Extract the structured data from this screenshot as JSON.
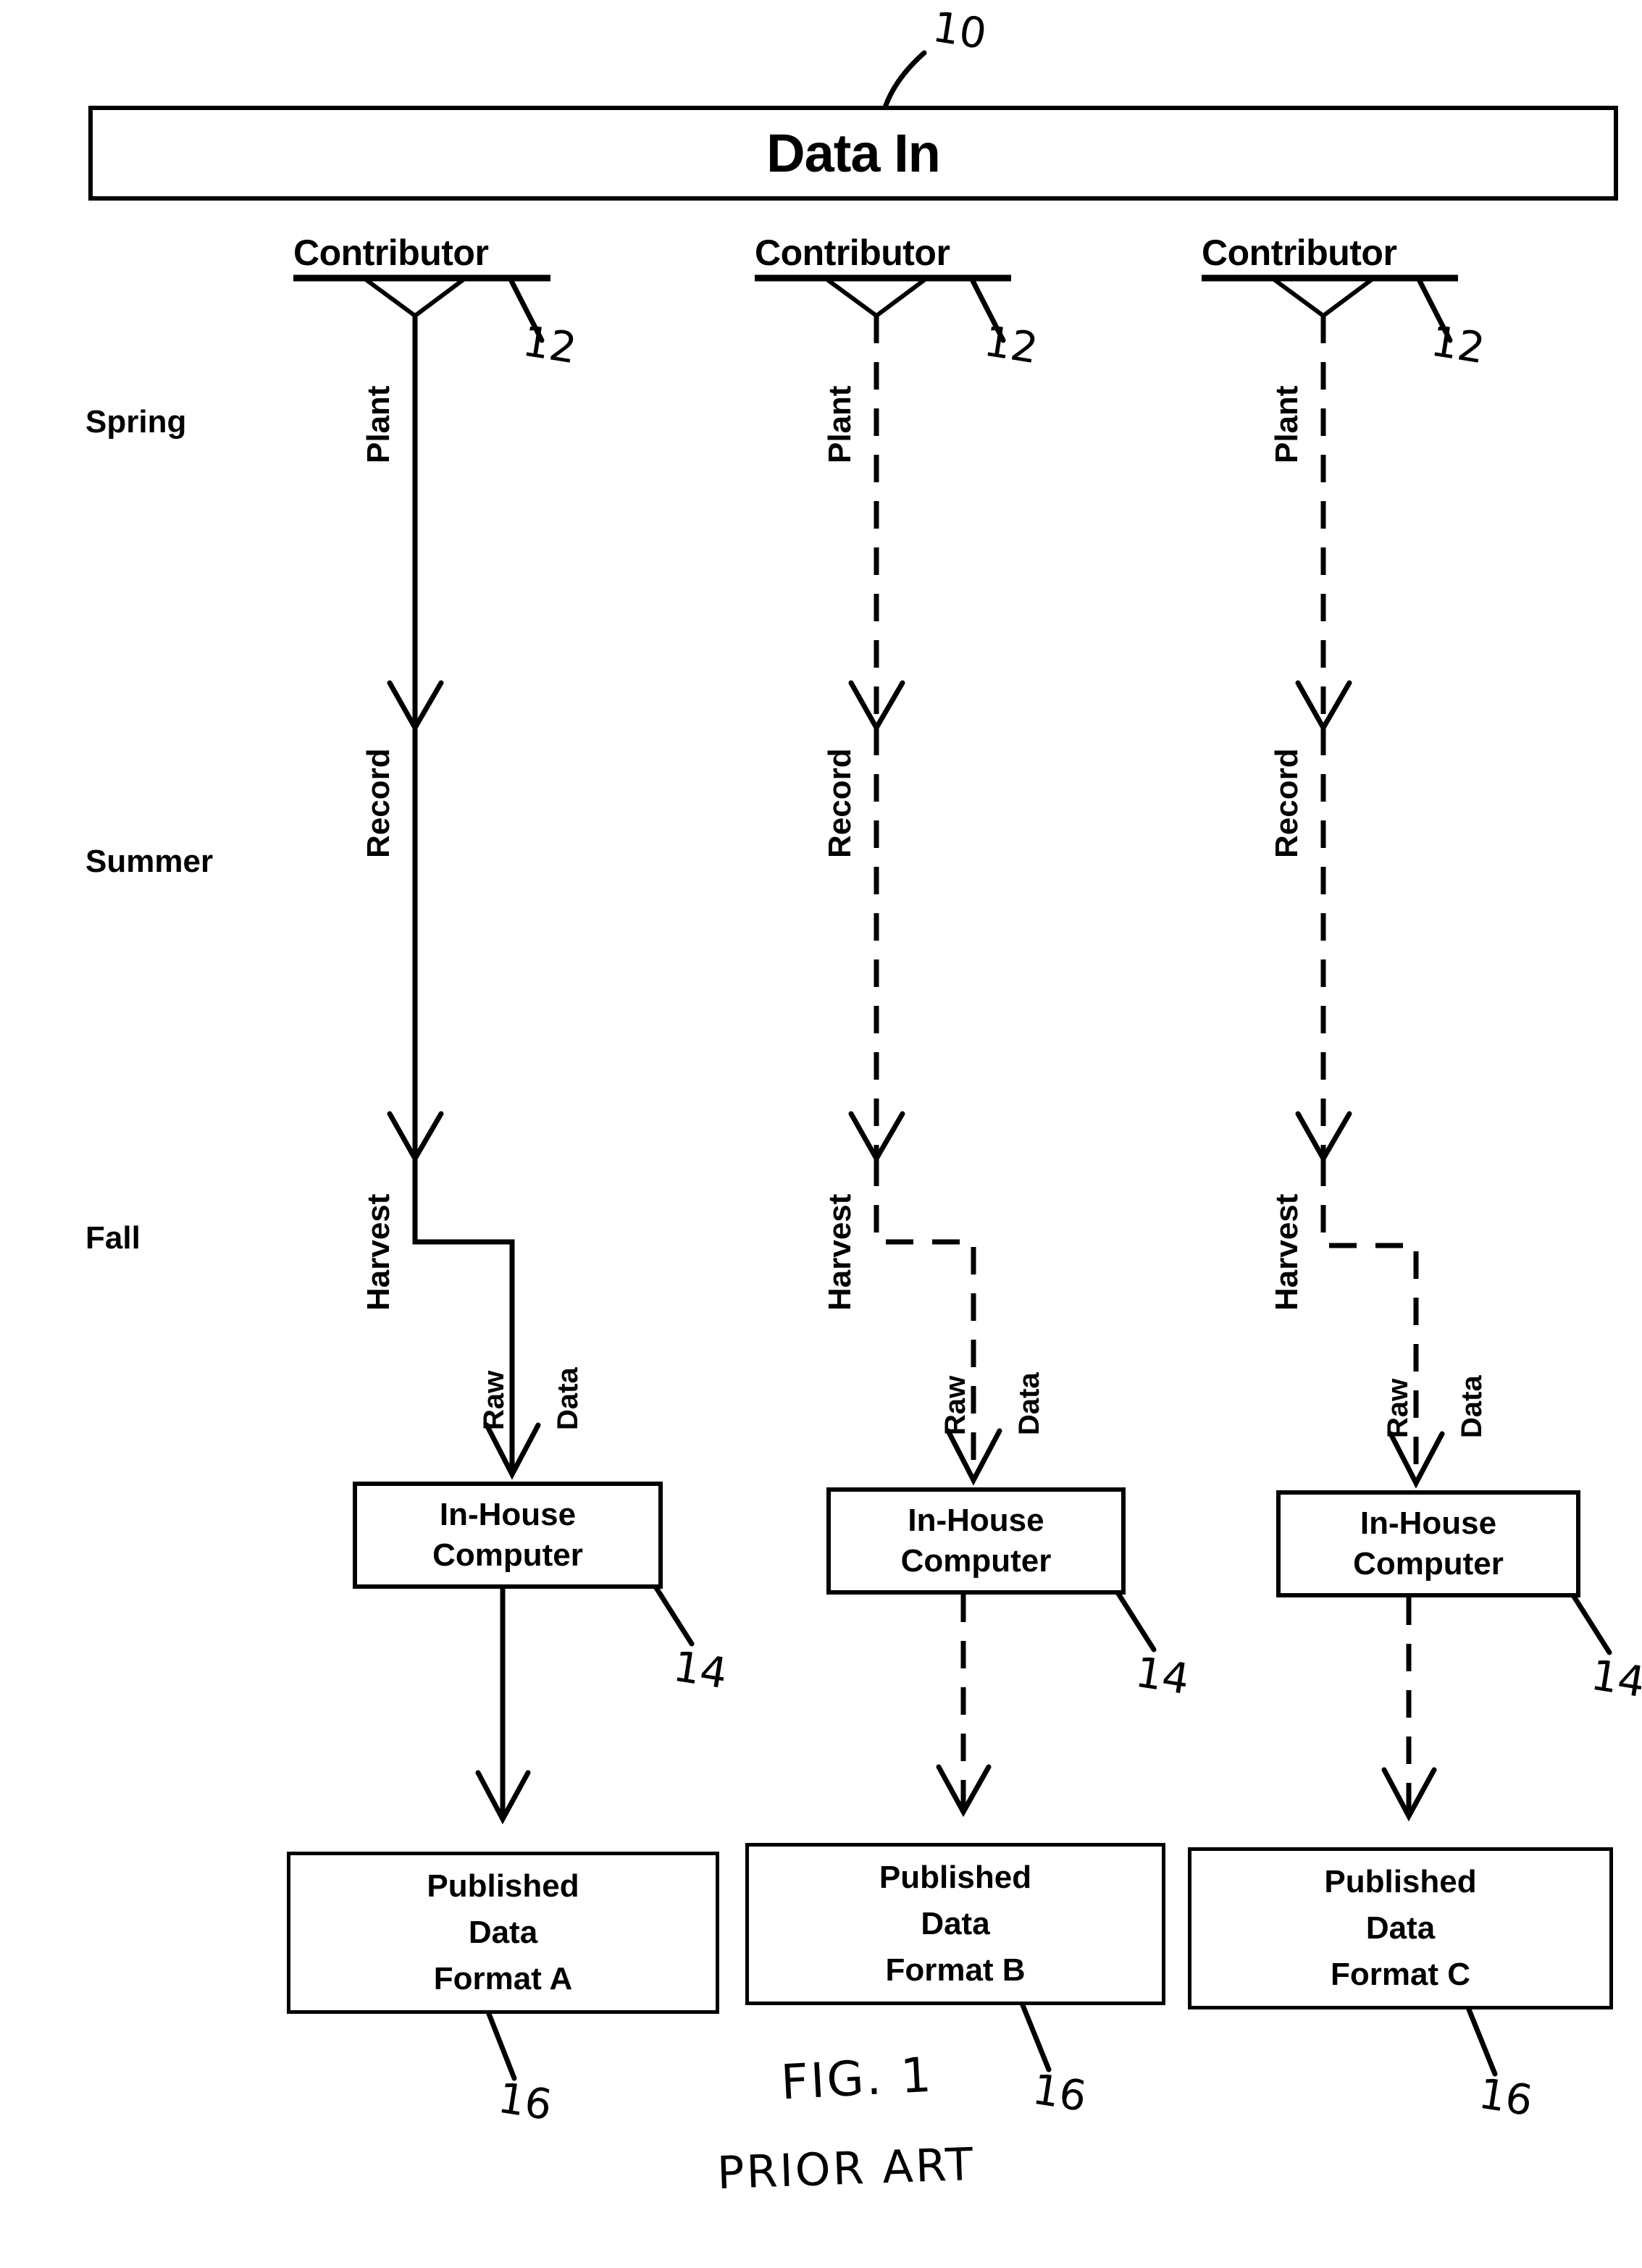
{
  "figure": {
    "title": "Data In flow diagram",
    "fig_label": "FIG. 1",
    "prior_art_label": "PRIOR ART",
    "ref_10": "10",
    "ref_12": "12",
    "ref_14": "14",
    "ref_16": "16"
  },
  "header": {
    "label": "Data In"
  },
  "seasons": [
    {
      "label": "Spring"
    },
    {
      "label": "Summer"
    },
    {
      "label": "Fall"
    }
  ],
  "stage_labels": {
    "plant": "Plant",
    "record": "Record",
    "harvest": "Harvest",
    "raw": "Raw",
    "data": "Data"
  },
  "columns": [
    {
      "contributor": "Contributor",
      "plant": "Plant",
      "record": "Record",
      "harvest": "Harvest",
      "raw": "Raw",
      "data": "Data",
      "computer_line1": "In-House",
      "computer_line2": "Computer",
      "published_line1": "Published",
      "published_line2": "Data",
      "published_line3": "Format A",
      "line_style": "solid",
      "ref_contributor": "12",
      "ref_computer": "14",
      "ref_published": "16"
    },
    {
      "contributor": "Contributor",
      "plant": "Plant",
      "record": "Record",
      "harvest": "Harvest",
      "raw": "Raw",
      "data": "Data",
      "computer_line1": "In-House",
      "computer_line2": "Computer",
      "published_line1": "Published",
      "published_line2": "Data",
      "published_line3": "Format B",
      "line_style": "dashed",
      "ref_contributor": "12",
      "ref_computer": "14",
      "ref_published": "16"
    },
    {
      "contributor": "Contributor",
      "plant": "Plant",
      "record": "Record",
      "harvest": "Harvest",
      "raw": "Raw",
      "data": "Data",
      "computer_line1": "In-House",
      "computer_line2": "Computer",
      "published_line1": "Published",
      "published_line2": "Data",
      "published_line3": "Format C",
      "line_style": "dashed",
      "ref_contributor": "12",
      "ref_computer": "14",
      "ref_published": "16"
    }
  ],
  "colors": {
    "ink": "#000000",
    "paper": "#ffffff"
  }
}
